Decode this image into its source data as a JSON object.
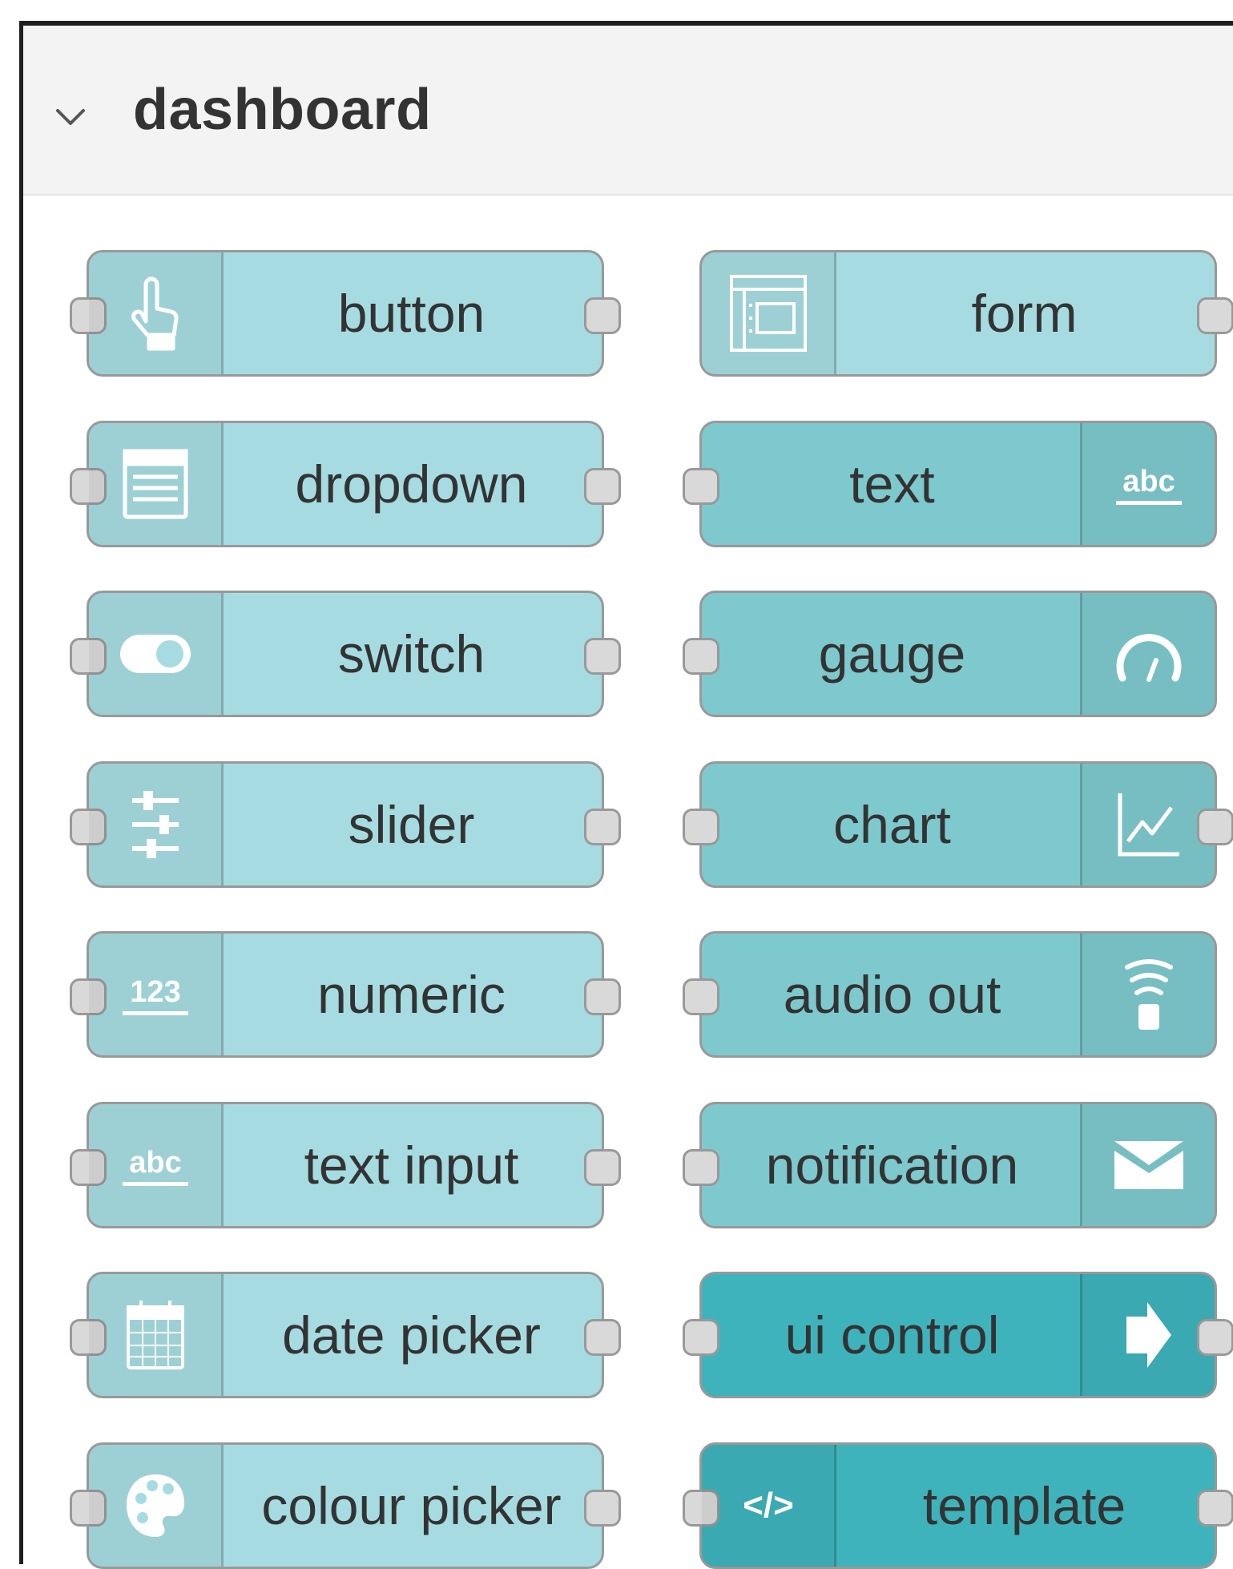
{
  "palette": {
    "title": "dashboard",
    "expand_icon": "chevron-down-icon",
    "colors": {
      "input_node": "#a6dce1",
      "output_node": "#7ec9cd",
      "control_node": "#3fb3bb",
      "header_bg": "#f3f3f3",
      "port": "#d9d9d9",
      "border": "#999999"
    },
    "nodes": [
      {
        "label": "button",
        "icon": "hand-pointer-icon"
      },
      {
        "label": "form",
        "icon": "form-icon"
      },
      {
        "label": "dropdown",
        "icon": "list-icon"
      },
      {
        "label": "text",
        "icon": "abc-icon",
        "icon_text": "abc"
      },
      {
        "label": "switch",
        "icon": "toggle-icon"
      },
      {
        "label": "gauge",
        "icon": "gauge-icon"
      },
      {
        "label": "slider",
        "icon": "sliders-icon"
      },
      {
        "label": "chart",
        "icon": "line-chart-icon"
      },
      {
        "label": "numeric",
        "icon": "numeric-icon",
        "icon_text": "123"
      },
      {
        "label": "audio out",
        "icon": "audio-signal-icon"
      },
      {
        "label": "text input",
        "icon": "abc-icon",
        "icon_text": "abc"
      },
      {
        "label": "notification",
        "icon": "envelope-icon"
      },
      {
        "label": "date picker",
        "icon": "calendar-icon"
      },
      {
        "label": "ui control",
        "icon": "arrow-right-icon"
      },
      {
        "label": "colour picker",
        "icon": "palette-icon"
      },
      {
        "label": "template",
        "icon": "code-icon",
        "icon_text": "</>"
      }
    ]
  }
}
